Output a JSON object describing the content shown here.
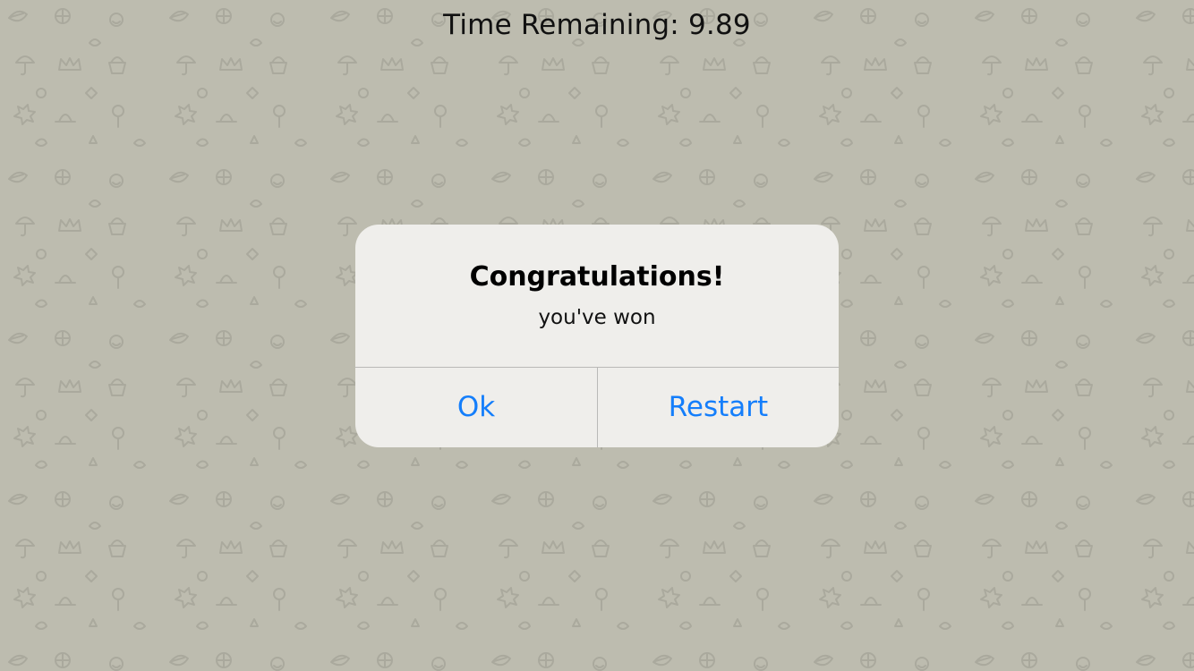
{
  "timer": {
    "label": "Time Remaining: 9.89"
  },
  "alert": {
    "title": "Congratulations!",
    "message": "you've won",
    "buttons": {
      "ok": "Ok",
      "restart": "Restart"
    }
  },
  "colors": {
    "background": "#bdbcaf",
    "pattern": "#a9a99d",
    "alert_bg": "#efeeeb",
    "button_text": "#147efb"
  },
  "pattern_icons": [
    "leaf-icon",
    "paw-icon",
    "cupcake-icon",
    "lollipop-icon",
    "smile-icon",
    "ball-icon",
    "umbrella-icon",
    "crown-icon",
    "hat-icon"
  ]
}
